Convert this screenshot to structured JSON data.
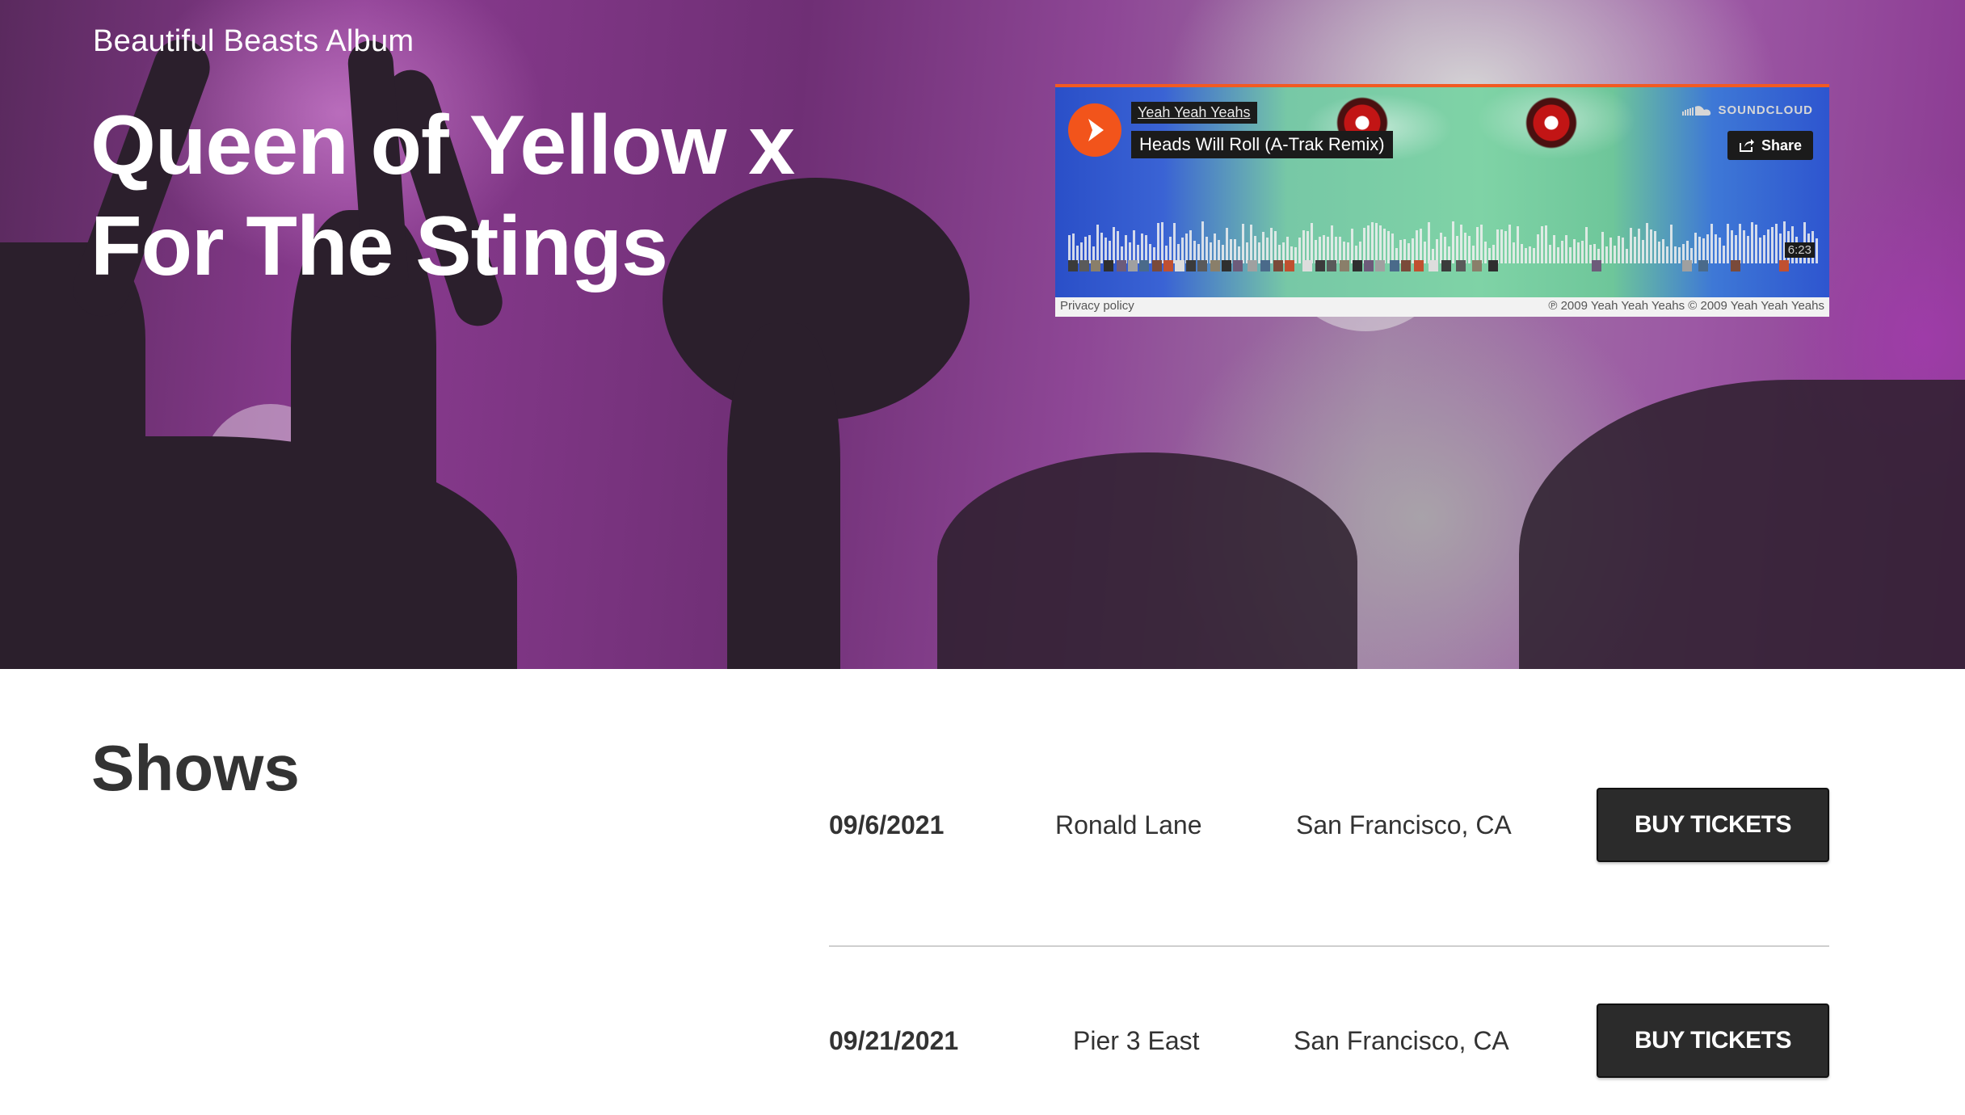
{
  "hero": {
    "subtitle": "Beautiful Beasts Album",
    "title": "Queen of Yellow x For The Stings"
  },
  "player": {
    "artist": "Yeah Yeah Yeahs",
    "track": "Heads Will Roll (A-Trak Remix)",
    "brand": "SOUNDCLOUD",
    "share_label": "Share",
    "duration": "6:23",
    "privacy_label": "Privacy policy",
    "copyright": "℗ 2009 Yeah Yeah Yeahs © 2009 Yeah Yeah Yeahs",
    "colors": {
      "play": "#f2541b",
      "accent": "#f25a22"
    },
    "icons": [
      "play-icon",
      "soundcloud-logo-icon",
      "share-icon"
    ]
  },
  "shows": {
    "title": "Shows",
    "rows": [
      {
        "date": "09/6/2021",
        "venue": "Ronald Lane",
        "city": "San Francisco, CA",
        "button": "BUY TICKETS"
      },
      {
        "date": "09/21/2021",
        "venue": "Pier 3 East",
        "city": "San Francisco, CA",
        "button": "BUY TICKETS"
      }
    ]
  }
}
